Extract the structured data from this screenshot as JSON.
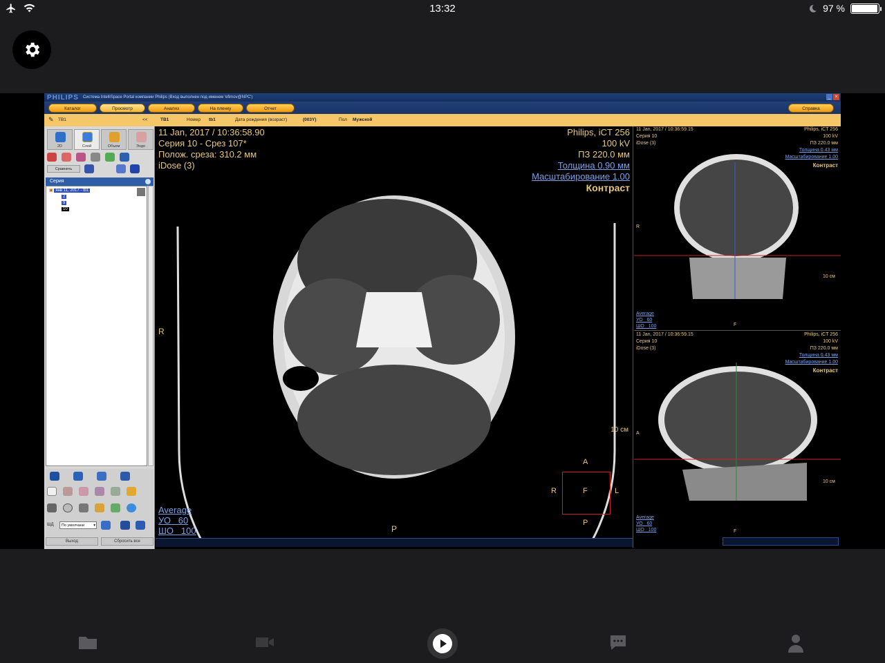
{
  "status": {
    "time": "13:32",
    "battery": "97 %",
    "battery_level": 0.97
  },
  "window": {
    "brand": "PHILIPS",
    "title": "Система IntelliSpace Portal компании Philips (Вход выполнен под именем 'efimov@NPC')"
  },
  "menu": {
    "katalog": "Каталог",
    "prosmotr": "Просмотр",
    "analiz": "Анализ",
    "naplenku": "На пленку",
    "otchet": "Отчет",
    "help": "Справка"
  },
  "info": {
    "tab": "ТВ1",
    "collapse": "<<",
    "patient": "ТВ1",
    "nomer_label": "Номер",
    "nomer_value": "tb1",
    "dob_label": "Дата рождения (возраст)",
    "dob_value": "(003Y)",
    "sex_label": "Пол",
    "sex_value": "Мужской"
  },
  "left": {
    "tabs": [
      "2D",
      "Слой",
      "Объем",
      "Эндо"
    ],
    "compare": "Сравнить",
    "series_header": "Серия",
    "series_root": "янв 11, 2017 - tb1",
    "series_items": [
      "2",
      "9",
      "10"
    ],
    "shd_label": "ШД",
    "shd_value": "По умолчани",
    "exit": "Выход",
    "reset": "Сбросить все"
  },
  "main": {
    "date": "11 Jan, 2017 / 10:36:58.90",
    "series": "Серия 10 - Срез 107*",
    "position": "Полож. среза: 310.2 мм",
    "idose": "iDose (3)",
    "scanner": "Philips, iCT 256",
    "kv": "100 kV",
    "fov": "ПЗ 220.0 мм",
    "thickness": "Толщина 0.90 мм",
    "scale": "Масштабирование 1.00",
    "contrast": "Контраст",
    "window_mode": "Average",
    "wl": "УО   60",
    "ww": "ШО   100",
    "r_label": "R",
    "p_label": "P",
    "ruler": "10 см",
    "orient": {
      "a": "A",
      "r": "R",
      "f": "F",
      "l": "L",
      "p": "P"
    }
  },
  "coronal": {
    "date": "11 Jan, 2017 / 10:36:59.15",
    "series": "Серия 10",
    "idose": "iDose (3)",
    "scanner": "Philips, iCT 256",
    "kv": "100 kV",
    "fov": "ПЗ 220.0 мм",
    "thickness": "Толщина 0.43 мм",
    "scale": "Масштабирование 1.00",
    "contrast": "Контраст",
    "r_label": "R",
    "f_label": "F",
    "ruler": "10 см",
    "window_mode": "Average",
    "wl": "УО   60",
    "ww": "ШО   100"
  },
  "sagittal": {
    "date": "11 Jan, 2017 / 10:36:59.15",
    "series": "Серия 10",
    "idose": "iDose (3)",
    "scanner": "Philips, iCT 256",
    "kv": "100 kV",
    "fov": "ПЗ 220.0 мм",
    "thickness": "Толщина 0.43 мм",
    "scale": "Масштабирование 1.00",
    "contrast": "Контраст",
    "a_label": "A",
    "f_label": "F",
    "ruler": "10 см",
    "window_mode": "Average",
    "wl": "УО   60",
    "ww": "ШО   100"
  },
  "tabbar": {
    "items": [
      "folder-icon",
      "video-icon",
      "play-icon",
      "chat-icon",
      "profile-icon"
    ]
  }
}
